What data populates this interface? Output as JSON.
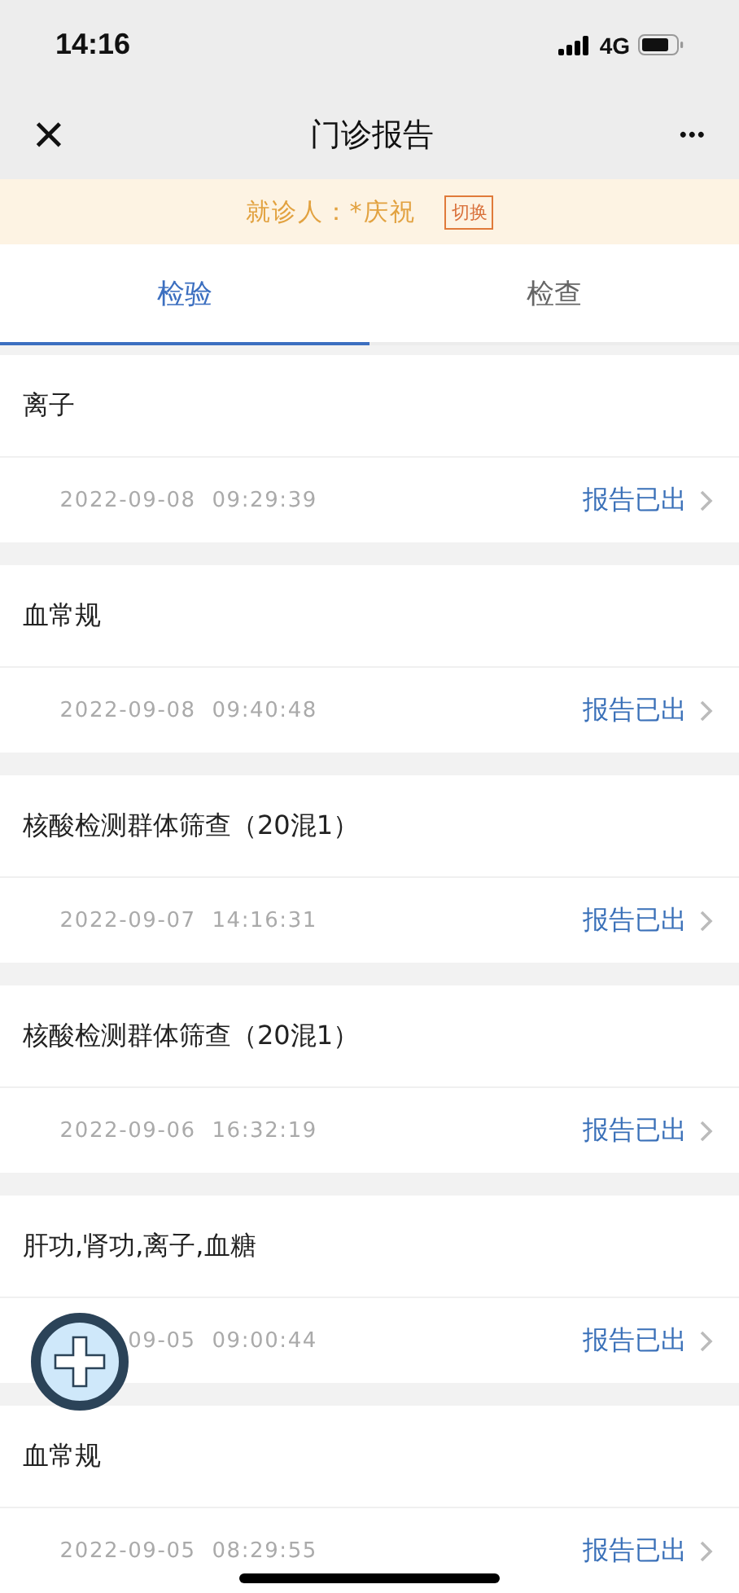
{
  "status_bar": {
    "time": "14:16",
    "network": "4G"
  },
  "nav": {
    "title": "门诊报告",
    "close": "×",
    "more": "•••"
  },
  "patient_bar": {
    "label": "就诊人：*庆祝",
    "switch": "切换"
  },
  "tabs": [
    {
      "label": "检验",
      "selected": true
    },
    {
      "label": "检查",
      "selected": false
    }
  ],
  "reports": [
    {
      "name": "离子",
      "time": "2022-09-08  09:29:39",
      "status": "报告已出"
    },
    {
      "name": "血常规",
      "time": "2022-09-08  09:40:48",
      "status": "报告已出"
    },
    {
      "name": "核酸检测群体筛查（20混1）",
      "time": "2022-09-07  14:16:31",
      "status": "报告已出"
    },
    {
      "name": "核酸检测群体筛查（20混1）",
      "time": "2022-09-06  16:32:19",
      "status": "报告已出"
    },
    {
      "name": "肝功,肾功,离子,血糖",
      "time": "09-05  09:00:44",
      "status": "报告已出"
    },
    {
      "name": "血常规",
      "time": "2022-09-05  08:29:55",
      "status": "报告已出"
    }
  ]
}
